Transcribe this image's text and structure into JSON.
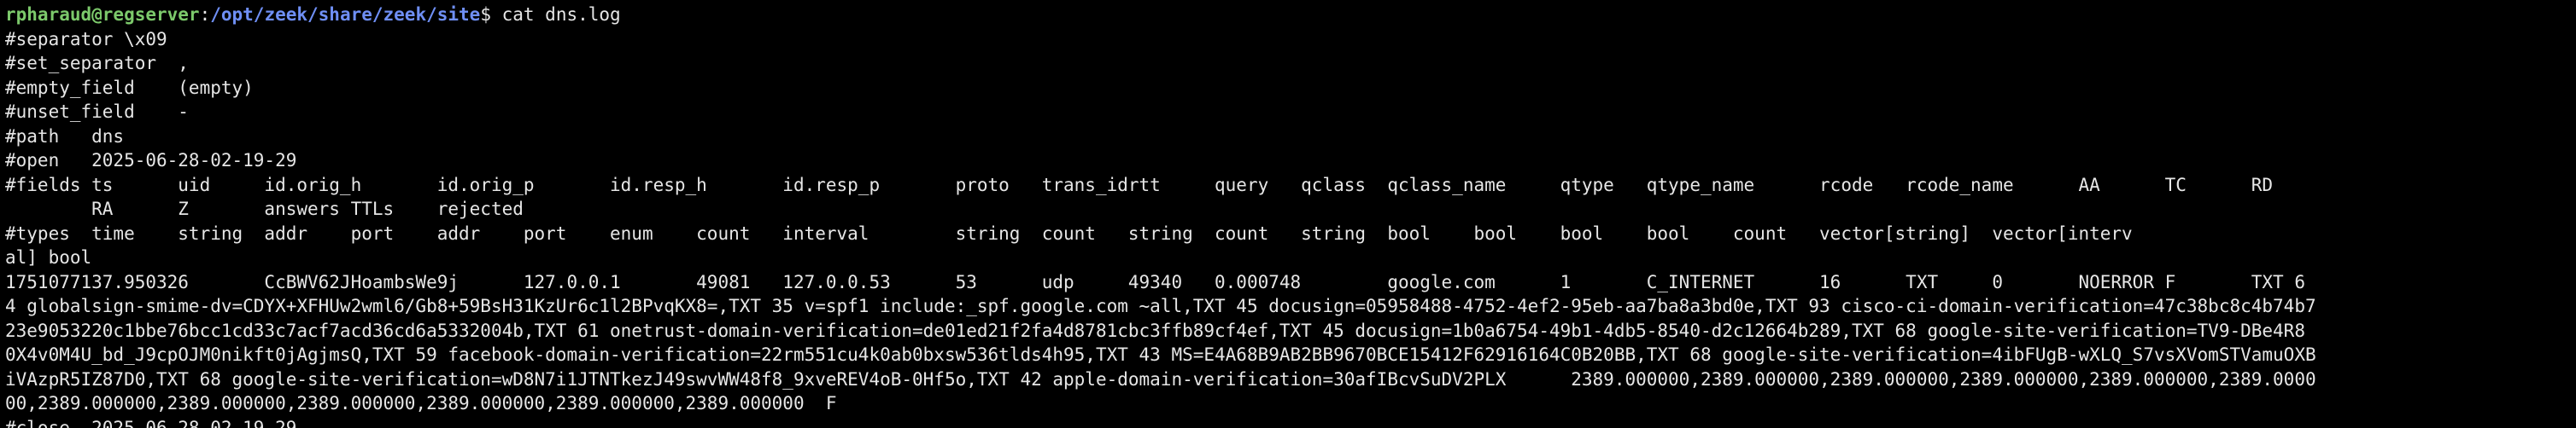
{
  "window": {
    "background": "#000000",
    "foreground": "#e6e6e6",
    "prompt_user_color": "#7cc96b",
    "prompt_path_color": "#6f8ff5"
  },
  "prompt": {
    "user_host": "rpharaud@regserver",
    "separator": ":",
    "path": "/opt/zeek/share/zeek/site",
    "symbol": "$",
    "command": " cat dns.log"
  },
  "output_lines": [
    "#separator \\x09",
    "#set_separator  ,",
    "#empty_field    (empty)",
    "#unset_field    -",
    "#path   dns",
    "#open   2025-06-28-02-19-29",
    "#fields ts      uid     id.orig_h       id.orig_p       id.resp_h       id.resp_p       proto   trans_idrtt     query   qclass  qclass_name     qtype   qtype_name      rcode   rcode_name      AA      TC      RD",
    "        RA      Z       answers TTLs    rejected",
    "#types  time    string  addr    port    addr    port    enum    count   interval        string  count   string  count   string  bool    bool    bool    bool    count   vector[string]  vector[interv",
    "al] bool",
    "1751077137.950326       CcBWV62JHoambsWe9j      127.0.0.1       49081   127.0.0.53      53      udp     49340   0.000748        google.com      1       C_INTERNET      16      TXT     0       NOERROR F       TXT 6",
    "4 globalsign-smime-dv=CDYX+XFHUw2wml6/Gb8+59BsH31KzUr6c1l2BPvqKX8=,TXT 35 v=spf1 include:_spf.google.com ~all,TXT 45 docusign=05958488-4752-4ef2-95eb-aa7ba8a3bd0e,TXT 93 cisco-ci-domain-verification=47c38bc8c4b74b7",
    "23e9053220c1bbe76bcc1cd33c7acf7acd36cd6a5332004b,TXT 61 onetrust-domain-verification=de01ed21f2fa4d8781cbc3ffb89cf4ef,TXT 45 docusign=1b0a6754-49b1-4db5-8540-d2c12664b289,TXT 68 google-site-verification=TV9-DBe4R8",
    "0X4v0M4U_bd_J9cpOJM0nikft0jAgjmsQ,TXT 59 facebook-domain-verification=22rm551cu4k0ab0bxsw536tlds4h95,TXT 43 MS=E4A68B9AB2BB9670BCE15412F62916164C0B20BB,TXT 68 google-site-verification=4ibFUgB-wXLQ_S7vsXVomSTVamuOXB",
    "iVAzpR5IZ87D0,TXT 68 google-site-verification=wD8N7i1JTNTkezJ49swvWW48f8_9xveREV4oB-0Hf5o,TXT 42 apple-domain-verification=30afIBcvSuDV2PLX      2389.000000,2389.000000,2389.000000,2389.000000,2389.000000,2389.0000",
    "00,2389.000000,2389.000000,2389.000000,2389.000000,2389.000000,2389.000000  F",
    "#close  2025-06-28-02-19-29"
  ]
}
